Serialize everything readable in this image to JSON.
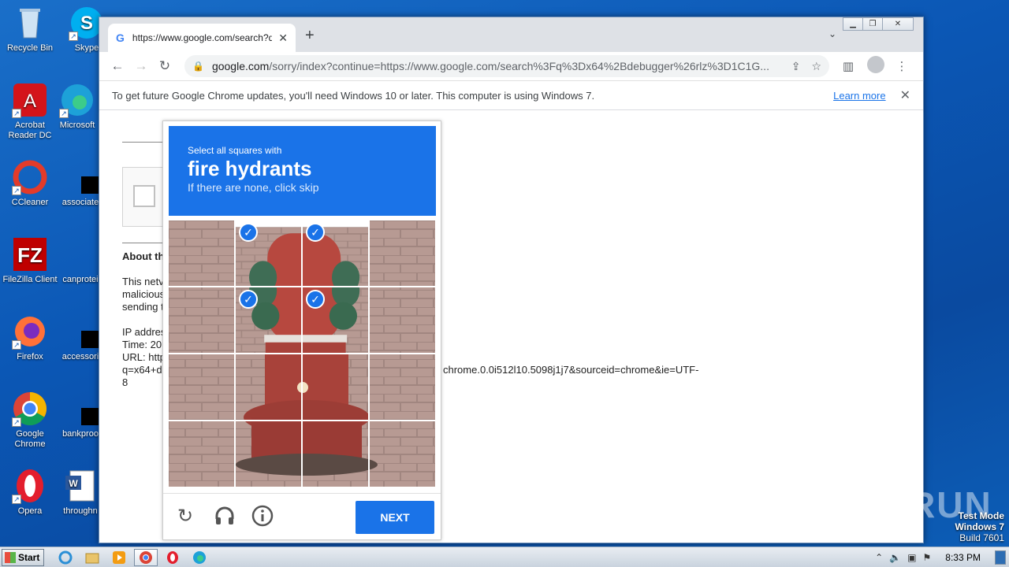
{
  "desktop": {
    "icons": [
      {
        "label": "Recycle Bin"
      },
      {
        "label": "Skype"
      },
      {
        "label": "Acrobat Reader DC"
      },
      {
        "label": "Microsoft"
      },
      {
        "label": "CCleaner"
      },
      {
        "label": "associate"
      },
      {
        "label": "FileZilla Client"
      },
      {
        "label": "canprotei"
      },
      {
        "label": "Firefox"
      },
      {
        "label": "accessori"
      },
      {
        "label": "Google Chrome"
      },
      {
        "label": "bankproo"
      },
      {
        "label": "Opera"
      },
      {
        "label": "throughn"
      }
    ]
  },
  "browser": {
    "tab_title": "https://www.google.com/search?q=",
    "address": {
      "host": "google.com",
      "rest": "/sorry/index?continue=https://www.google.com/search%3Fq%3Dx64%2Bdebugger%26rlz%3D1C1G..."
    },
    "infobar": {
      "message": "To get future Google Chrome updates, you'll need Windows 10 or later. This computer is using Windows 7.",
      "link": "Learn more"
    }
  },
  "page": {
    "about_heading": "About th",
    "para1_line1": "This netv",
    "para1_line2": "malicious",
    "para1_line3": "sending t",
    "ip_line": "IP addres",
    "time_line": "Time: 20",
    "url_line": "URL: http",
    "url_line2_start": "q=x64+d",
    "url_line2_end": "chrome.0.0i512l10.5098j1j7&sourceid=chrome&ie=UTF-",
    "url_line3": "8"
  },
  "captcha": {
    "instruction_line1": "Select all squares with",
    "target": "fire hydrants",
    "hint": "If there are none, click skip",
    "selected_tiles": [
      1,
      2,
      5,
      6
    ],
    "next_label": "NEXT"
  },
  "watermark": {
    "text": "ANY RUN",
    "mode_line1": "Test Mode",
    "mode_line2": "Windows 7",
    "mode_line3": "Build 7601"
  },
  "taskbar": {
    "start_label": "Start",
    "clock": "8:33 PM"
  }
}
